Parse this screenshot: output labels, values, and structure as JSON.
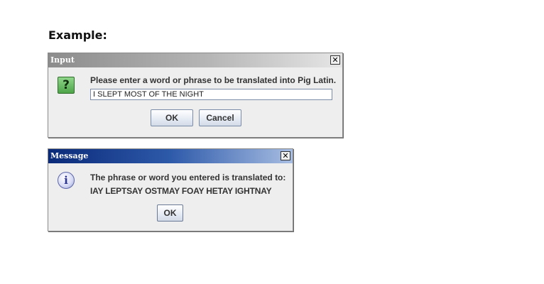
{
  "heading": "Example:",
  "input_dialog": {
    "title": "Input",
    "close_glyph": "✕",
    "icon": "question-icon",
    "icon_glyph": "?",
    "prompt": "Please enter a word or phrase to be translated into Pig Latin.",
    "field_value": "I SLEPT MOST OF THE NIGHT",
    "ok_label": "OK",
    "cancel_label": "Cancel"
  },
  "message_dialog": {
    "title": "Message",
    "close_glyph": "✕",
    "icon": "info-icon",
    "icon_glyph": "i",
    "line1": "The phrase or word you entered is translated to:",
    "line2": "IAY LEPTSAY OSTMAY FOAY HETAY IGHTNAY",
    "ok_label": "OK"
  },
  "colors": {
    "inactive_title": "#a0a0a0",
    "active_title": "#1c3f8e",
    "dialog_bg": "#eeeeee"
  }
}
